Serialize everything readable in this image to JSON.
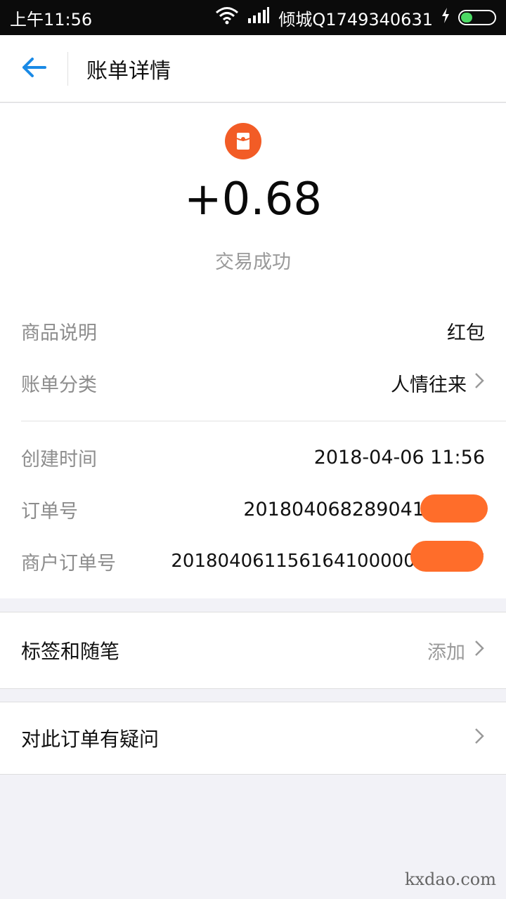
{
  "status_bar": {
    "time": "上午11:56",
    "carrier": "倾城Q1749340631",
    "battery_level": 0.35
  },
  "header": {
    "title": "账单详情",
    "accent_color": "#1a8ae6"
  },
  "summary": {
    "amount": "+0.68",
    "status": "交易成功",
    "icon_color": "#f25c26"
  },
  "details": {
    "product_label": "商品说明",
    "product_value": "红包",
    "category_label": "账单分类",
    "category_value": "人情往来",
    "created_label": "创建时间",
    "created_value": "2018-04-06 11:56",
    "order_label": "订单号",
    "order_value": "201804068289041",
    "merchant_order_label": "商户订单号",
    "merchant_order_value": "201804061156164100000000007"
  },
  "tags_card": {
    "label": "标签和随笔",
    "action": "添加"
  },
  "question_card": {
    "label": "对此订单有疑问"
  },
  "watermark": "kxdao.com"
}
